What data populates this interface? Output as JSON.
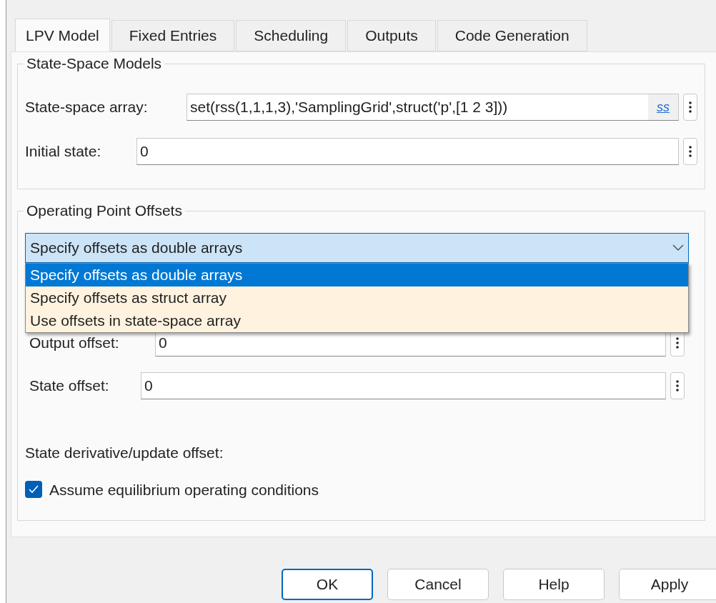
{
  "tabs": [
    {
      "label": "LPV Model",
      "selected": true
    },
    {
      "label": "Fixed Entries",
      "selected": false
    },
    {
      "label": "Scheduling",
      "selected": false
    },
    {
      "label": "Outputs",
      "selected": false
    },
    {
      "label": "Code Generation",
      "selected": false
    }
  ],
  "state_space_models": {
    "title": "State-Space Models",
    "fields": [
      {
        "kind": "with_link",
        "label": "State-space array:",
        "value": "set(rss(1,1,1,3),'SamplingGrid',struct('p',[1 2 3]))",
        "link": "ss"
      },
      {
        "kind": "plain",
        "label": "Initial state:",
        "value": "0"
      }
    ]
  },
  "operating_point_offsets": {
    "title": "Operating Point Offsets",
    "mode_select": {
      "value": "Specify offsets as double arrays",
      "expanded": true,
      "options": [
        {
          "label": "Specify offsets as double arrays",
          "selected": true
        },
        {
          "label": "Specify offsets as struct array",
          "selected": false
        },
        {
          "label": "Use offsets in state-space array",
          "selected": false
        }
      ]
    },
    "fields": [
      {
        "kind": "plain",
        "label": "Output offset:",
        "value": "0"
      },
      {
        "kind": "plain",
        "label": "State offset:",
        "value": "0"
      }
    ],
    "derivative_label": "State derivative/update offset:",
    "checkbox": {
      "label": "Assume equilibrium operating conditions",
      "checked": true
    }
  },
  "buttons": [
    {
      "label": "OK",
      "focused": true
    },
    {
      "label": "Cancel",
      "focused": false
    },
    {
      "label": "Help",
      "focused": false
    },
    {
      "label": "Apply",
      "focused": false
    }
  ]
}
